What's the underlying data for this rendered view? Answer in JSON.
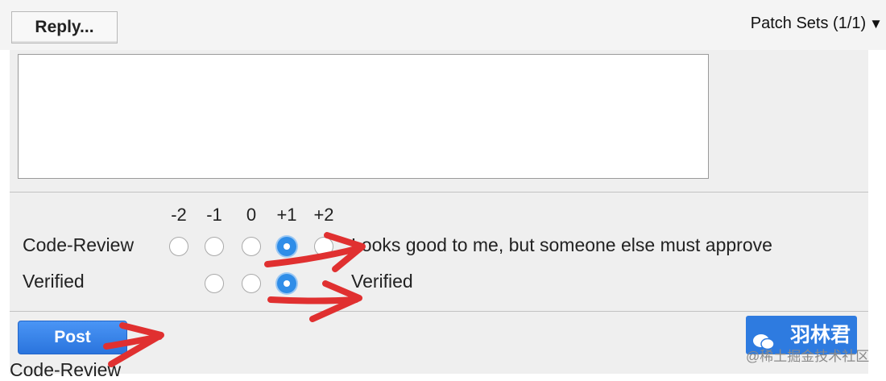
{
  "header": {
    "reply_label": "Reply...",
    "patch_sets_label": "Patch Sets (1/1)",
    "patch_sets_toggle": "▼"
  },
  "review": {
    "comment_value": "",
    "scale": [
      "-2",
      "-1",
      "0",
      "+1",
      "+2"
    ],
    "labels": [
      {
        "name": "Code-Review",
        "options": [
          "-2",
          "-1",
          "0",
          "+1",
          "+2"
        ],
        "selected": "+1",
        "description": "Looks good to me, but someone else must approve"
      },
      {
        "name": "Verified",
        "options": [
          "-1",
          "0",
          "+1"
        ],
        "selected": "+1",
        "description": "Verified"
      }
    ]
  },
  "actions": {
    "post_label": "Post"
  },
  "footer": {
    "next_heading": "Code-Review"
  },
  "watermark": {
    "title": "羽林君",
    "site": "@稀土掘金技术社区"
  },
  "colors": {
    "accent": "#2f8de8",
    "post_button": "#2a74dd",
    "annotation_arrow": "#e03030",
    "panel_bg": "#efefef"
  },
  "icons": {
    "patch_sets_toggle": "triangle-down-icon",
    "watermark": "wechat-icon"
  }
}
